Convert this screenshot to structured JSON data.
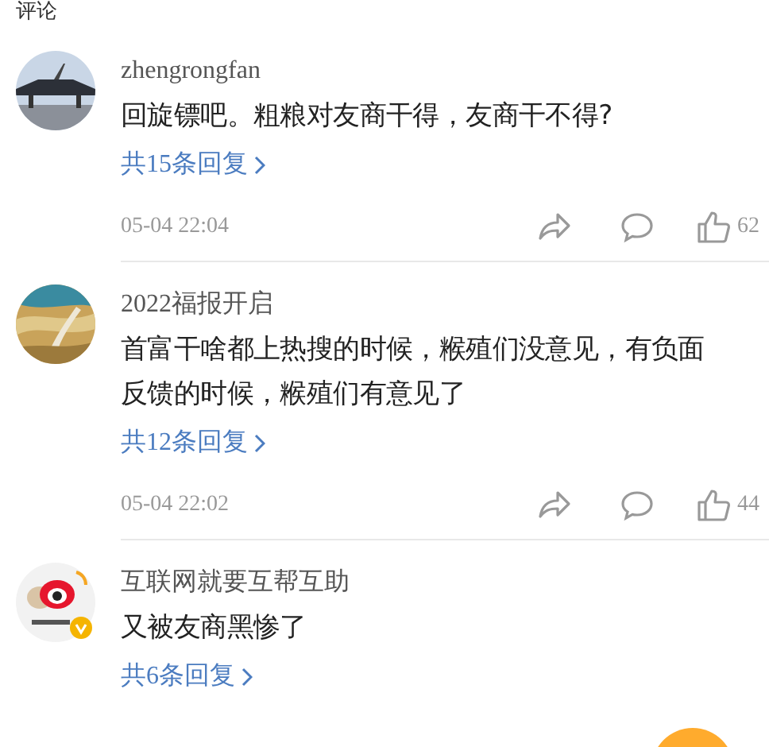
{
  "header": {
    "title": "评论"
  },
  "comments": [
    {
      "author": "zhengrongfan",
      "text": "回旋镖吧。粗粮对友商干得，友商干不得?",
      "replies": "共15条回复",
      "time": "05-04 22:04",
      "likes": "62",
      "liked": false
    },
    {
      "author": "2022福报开启",
      "text": "首富干啥都上热搜的时候，糇殖们没意见，有负面反馈的时候，糇殖们有意见了",
      "replies": "共12条回复",
      "time": "05-04 22:02",
      "likes": "44",
      "liked": false
    },
    {
      "avatar": {
        "kind": "logo",
        "verified": true
      },
      "author": "互联网就要互帮互助",
      "text": "又被友商黑惨了",
      "replies": "共6条回复"
    }
  ]
}
